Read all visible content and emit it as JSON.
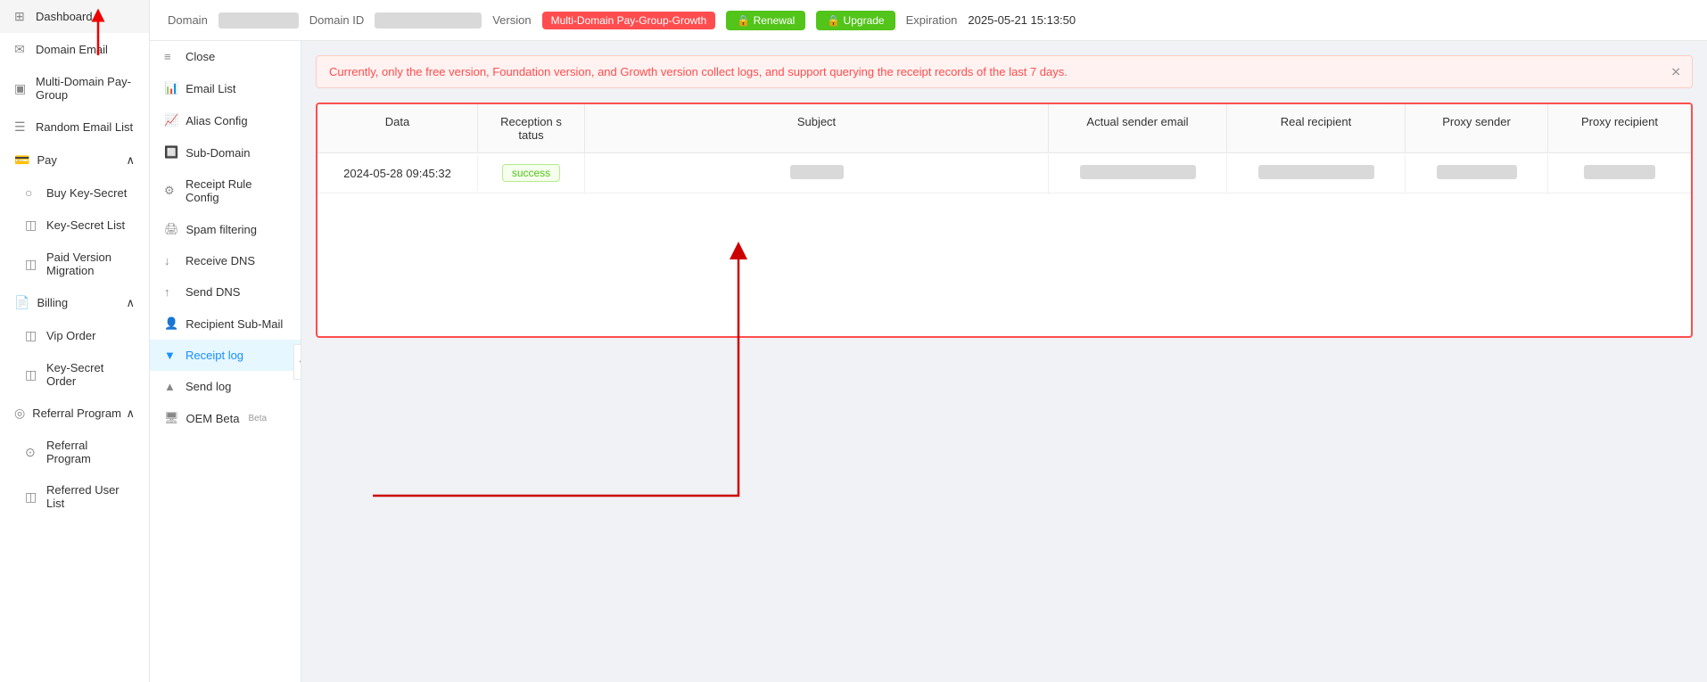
{
  "sidebar": {
    "items": [
      {
        "id": "dashboard",
        "label": "Dashboard",
        "icon": "⊞"
      },
      {
        "id": "domain-email",
        "label": "Domain Email",
        "icon": "✉"
      },
      {
        "id": "multi-domain",
        "label": "Multi-Domain Pay-Group",
        "icon": "▣"
      },
      {
        "id": "random-email",
        "label": "Random Email List",
        "icon": "☰"
      },
      {
        "id": "pay",
        "label": "Pay",
        "icon": "💳",
        "expandable": true,
        "expanded": true
      },
      {
        "id": "buy-key-secret",
        "label": "Buy Key-Secret",
        "icon": "○",
        "child": true
      },
      {
        "id": "key-secret-list",
        "label": "Key-Secret List",
        "icon": "◫",
        "child": true
      },
      {
        "id": "paid-version-migration",
        "label": "Paid Version Migration",
        "icon": "◫",
        "child": true
      },
      {
        "id": "billing",
        "label": "Billing",
        "icon": "📄",
        "expandable": true,
        "expanded": true
      },
      {
        "id": "vip-order",
        "label": "Vip Order",
        "icon": "◫",
        "child": true
      },
      {
        "id": "key-secret-order",
        "label": "Key-Secret Order",
        "icon": "◫",
        "child": true
      },
      {
        "id": "referral-program",
        "label": "Referral Program",
        "icon": "◎",
        "expandable": true,
        "expanded": true
      },
      {
        "id": "referral-program-sub",
        "label": "Referral Program",
        "icon": "⊙",
        "child": true
      },
      {
        "id": "referred-user-list",
        "label": "Referred User List",
        "icon": "◫",
        "child": true
      }
    ]
  },
  "header": {
    "domain_label": "Domain",
    "domain_value": "██████████",
    "domain_id_label": "Domain ID",
    "domain_id_value": "████████████████",
    "version_label": "Version",
    "version_badge": "Multi-Domain Pay-Group-Growth",
    "renewal_label": "🔒 Renewal",
    "upgrade_label": "🔒 Upgrade",
    "expiration_label": "Expiration",
    "expiration_value": "2025-05-21 15:13:50"
  },
  "sub_sidebar": {
    "items": [
      {
        "id": "close",
        "label": "Close",
        "icon": "≡",
        "active": false
      },
      {
        "id": "email-list",
        "label": "Email List",
        "icon": "📊",
        "active": false
      },
      {
        "id": "alias-config",
        "label": "Alias Config",
        "icon": "📈",
        "active": false
      },
      {
        "id": "sub-domain",
        "label": "Sub-Domain",
        "icon": "🔲",
        "active": false
      },
      {
        "id": "receipt-rule-config",
        "label": "Receipt Rule Config",
        "icon": "⚙",
        "active": false
      },
      {
        "id": "spam-filtering",
        "label": "Spam filtering",
        "icon": "🖨",
        "active": false
      },
      {
        "id": "receive-dns",
        "label": "Receive DNS",
        "icon": "↓",
        "active": false
      },
      {
        "id": "send-dns",
        "label": "Send DNS",
        "icon": "↑",
        "active": false
      },
      {
        "id": "recipient-sub-mail",
        "label": "Recipient Sub-Mail",
        "icon": "👤",
        "active": false
      },
      {
        "id": "receipt-log",
        "label": "Receipt log",
        "icon": "▼",
        "active": true
      },
      {
        "id": "send-log",
        "label": "Send log",
        "icon": "▲",
        "active": false
      },
      {
        "id": "oem",
        "label": "OEM Beta",
        "icon": "🖥",
        "active": false
      }
    ]
  },
  "alert": {
    "message": "Currently, only the free version, Foundation version, and Growth version collect logs, and support querying the receipt records of the last 7 days."
  },
  "table": {
    "columns": [
      "Data",
      "Reception status",
      "Subject",
      "Actual sender email",
      "Real recipient",
      "Proxy sender",
      "Proxy recipient"
    ],
    "rows": [
      {
        "date": "2024-05-28 09:45:32",
        "status": "success",
        "subject": "██",
        "actual_sender": "████████████",
        "real_recipient": "████████████",
        "proxy_sender": "████████",
        "proxy_recipient": "███████"
      }
    ]
  }
}
